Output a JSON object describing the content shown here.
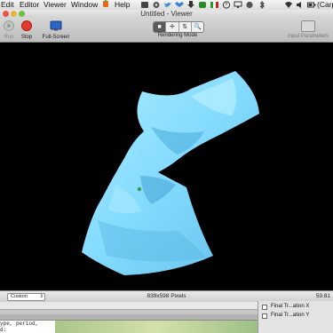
{
  "menubar": {
    "items": [
      "Edit",
      "Editor",
      "Viewer",
      "Window",
      "Help"
    ],
    "status_text": "(Carp",
    "apple_icon": "apple-icon",
    "colors": {
      "twitter": "#3a8fd9",
      "dropbox": "#3c7fd6",
      "badge": "#2c8a2c",
      "flag_red": "#d02020"
    }
  },
  "window": {
    "title": "Untitled - Viewer"
  },
  "toolbar": {
    "run_label": "Run",
    "stop_label": "Stop",
    "fullscreen_label": "Full-Screen",
    "rendering_mode_label": "Rendering Mode",
    "rendering_mode_segments": [
      "■",
      "✛",
      "⇅",
      "🔍"
    ],
    "input_params_label": "Input Parameters",
    "colors": {
      "stop": "#e23a2e",
      "run": "#9aa09a",
      "fullscreen": "#2b66c2"
    }
  },
  "viewport": {
    "background": "#000000",
    "shape_color": "#7dd8ff",
    "shape_dark": "#4aa9d9"
  },
  "statusbar": {
    "size_select_value": "Custom",
    "pixels_text": "839x598 Pixels",
    "fps_text": "59.81"
  },
  "lower": {
    "code_line1": "ype, period,",
    "code_line2": "d:"
  },
  "inspector": {
    "row1_label": "Final Tr...ation X",
    "row2_label": "Final Tr...ation Y"
  }
}
